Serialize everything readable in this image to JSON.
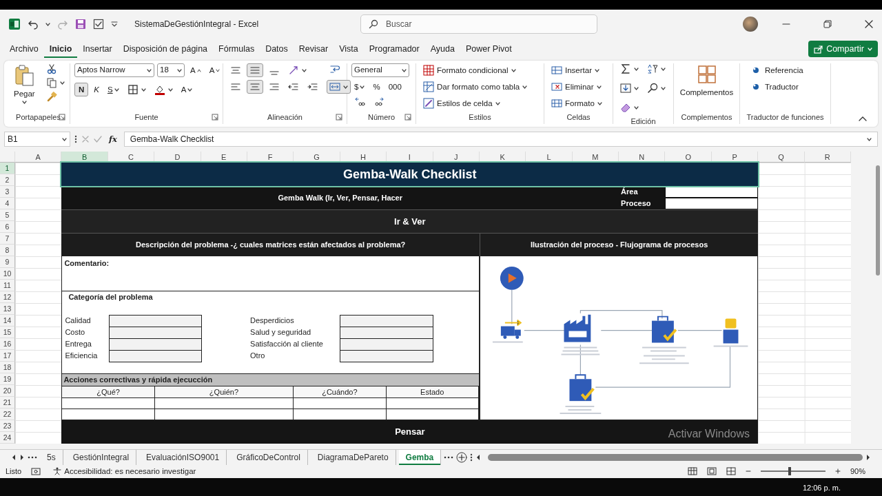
{
  "window": {
    "title": "SistemaDeGestiónIntegral - Excel"
  },
  "search": {
    "placeholder": "Buscar"
  },
  "menu": [
    {
      "label": "Archivo",
      "selected": false
    },
    {
      "label": "Inicio",
      "selected": true
    },
    {
      "label": "Insertar",
      "selected": false
    },
    {
      "label": "Disposición de página",
      "selected": false
    },
    {
      "label": "Fórmulas",
      "selected": false
    },
    {
      "label": "Datos",
      "selected": false
    },
    {
      "label": "Revisar",
      "selected": false
    },
    {
      "label": "Vista",
      "selected": false
    },
    {
      "label": "Programador",
      "selected": false
    },
    {
      "label": "Ayuda",
      "selected": false
    },
    {
      "label": "Power Pivot",
      "selected": false
    }
  ],
  "share_button": {
    "label": "Compartir"
  },
  "ribbon": [
    {
      "kind": "clipboard",
      "label": "Portapapeles",
      "paste": "Pegar"
    },
    {
      "kind": "font",
      "label": "Fuente",
      "font_name": "Aptos Narrow",
      "font_size": "18",
      "grow": "A",
      "shrink": "A",
      "bold": {
        "label": "N",
        "on": true
      },
      "italic": "K",
      "underline": "S",
      "font_color": "A"
    },
    {
      "kind": "alignment",
      "label": "Alineación",
      "middle_on": true,
      "center_on": true,
      "merge_on": true
    },
    {
      "kind": "number",
      "label": "Número",
      "format": "General",
      "currency": "$",
      "percent": "%",
      "thousands": "000"
    },
    {
      "kind": "styles",
      "label": "Estilos",
      "items": [
        "Formato condicional",
        "Dar formato como tabla",
        "Estilos de celda"
      ]
    },
    {
      "kind": "cells",
      "label": "Celdas",
      "items": [
        "Insertar",
        "Eliminar",
        "Formato"
      ]
    },
    {
      "kind": "editing",
      "label": "Edición"
    },
    {
      "kind": "addins",
      "label": "Complementos",
      "button": "Complementos"
    },
    {
      "kind": "translator",
      "label": "Traductor de funciones",
      "items": [
        "Referencia",
        "Traductor"
      ]
    }
  ],
  "formula_bar": {
    "cell": "B1",
    "fx": "fx",
    "value": "Gemba-Walk Checklist"
  },
  "columns": [
    "A",
    "B",
    "C",
    "D",
    "E",
    "F",
    "G",
    "H",
    "I",
    "J",
    "K",
    "L",
    "M",
    "N",
    "O",
    "P",
    "Q",
    "R"
  ],
  "rows": [
    "1",
    "2",
    "3",
    "4",
    "5",
    "6",
    "7",
    "8",
    "9",
    "10",
    "11",
    "12",
    "13",
    "14",
    "15",
    "16",
    "17",
    "18",
    "19",
    "20",
    "21",
    "22",
    "23",
    "24"
  ],
  "sheet": {
    "title": "Gemba-Walk Checklist",
    "subtitle": "Gemba Walk (Ir, Ver, Pensar, Hacer",
    "area_label": "Área",
    "process_label": "Proceso",
    "section_1": "Ir & Ver",
    "problem_heading": "Descripción del problema -¿ cuales matrices están afectados al problema?",
    "process_heading": "Ilustración del proceso - Flujograma de procesos",
    "comment_label": "Comentario:",
    "category_heading": "Categoría del problema",
    "categories_left": [
      "Calidad",
      "Costo",
      "Entrega",
      "Eficiencia"
    ],
    "categories_right": [
      "Desperdicios",
      "Salud y seguridad",
      "Satisfacción al cliente",
      "Otro"
    ],
    "actions_heading": "Acciones correctivas y rápida ejecucción",
    "action_columns": [
      "¿Qué?",
      "¿Quién?",
      "¿Cuándo?",
      "Estado"
    ],
    "section_2": "Pensar"
  },
  "windows_notice": "Activar Windows",
  "sheet_tabs": [
    {
      "label": "5s",
      "selected": false
    },
    {
      "label": "GestiónIntegral",
      "selected": false
    },
    {
      "label": "EvaluaciónISO9001",
      "selected": false
    },
    {
      "label": "GráficoDeControl",
      "selected": false
    },
    {
      "label": "DiagramaDePareto",
      "selected": false
    },
    {
      "label": "Gemba",
      "selected": true
    }
  ],
  "status_bar": {
    "ready": "Listo",
    "accessibility": "Accesibilidad: es necesario investigar",
    "zoom": "90%",
    "zoom_slider": {
      "level": 0.45
    }
  },
  "taskbar": {
    "time": "12:06 p. m."
  }
}
